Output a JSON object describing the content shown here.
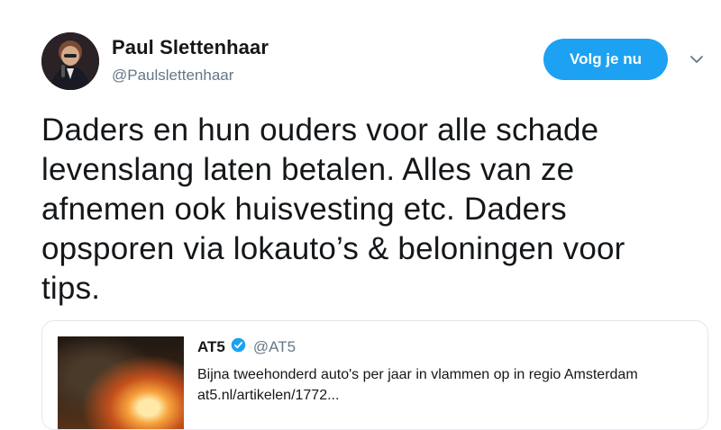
{
  "tweet": {
    "author": {
      "display_name": "Paul Slettenhaar",
      "handle": "@Paulslettenhaar"
    },
    "follow_label": "Volg je nu",
    "text": "Daders en hun ouders voor alle schade\nlevenslang laten betalen. Alles van ze\nafnemen ook huisvesting etc. Daders\nopsporen via lokauto’s & beloningen voor\ntips."
  },
  "quoted_tweet": {
    "author_name": "AT5",
    "author_handle": "@AT5",
    "text": "Bijna tweehonderd auto's per jaar in vlammen op in regio Amsterdam at5.nl/artikelen/1772..."
  },
  "icons": {
    "menu": "chevron-down-icon",
    "verified": "verified-badge-icon"
  },
  "colors": {
    "accent": "#1da1f2",
    "secondary_text": "#657786",
    "border": "#e1e8ed"
  }
}
